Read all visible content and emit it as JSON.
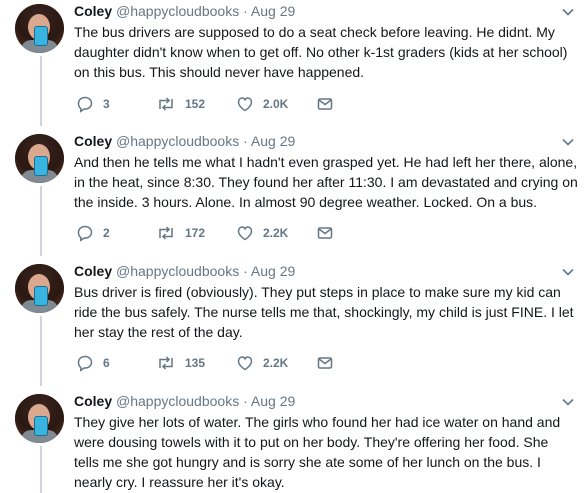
{
  "tweets": [
    {
      "name": "Coley",
      "handle": "@happycloudbooks",
      "sep": "·",
      "date": "Aug 29",
      "lines": [
        "The bus drivers are supposed to do a seat check before leaving. He didnt. My",
        "daughter didn't know when to get off. No other k-1st graders (kids at her school)",
        "on this bus. This should never have happened."
      ],
      "replies": "3",
      "retweets": "152",
      "likes": "2.0K"
    },
    {
      "name": "Coley",
      "handle": "@happycloudbooks",
      "sep": "·",
      "date": "Aug 29",
      "lines": [
        "And then he tells me what I hadn't even grasped yet. He had left her there, alone,",
        "in the heat, since 8:30. They found her after 11:30. I am devastated and crying on",
        "the inside. 3 hours. Alone. In almost 90 degree weather. Locked. On a bus."
      ],
      "replies": "2",
      "retweets": "172",
      "likes": "2.2K"
    },
    {
      "name": "Coley",
      "handle": "@happycloudbooks",
      "sep": "·",
      "date": "Aug 29",
      "lines": [
        "Bus driver is fired (obviously). They put steps in place to make sure my kid can",
        "ride the bus safely. The nurse tells me that, shockingly, my child is just FINE. I let",
        "her stay the rest of the day."
      ],
      "replies": "6",
      "retweets": "135",
      "likes": "2.2K"
    },
    {
      "name": "Coley",
      "handle": "@happycloudbooks",
      "sep": "·",
      "date": "Aug 29",
      "lines": [
        "They give her lots of water. The girls who found her had ice water on hand and",
        "were dousing towels with it to put on her body. They're offering her food. She",
        "tells me she got hungry and is sorry she ate some of her lunch on the bus. I",
        "nearly cry. I reassure her it's okay."
      ]
    }
  ],
  "colors": {
    "text": "#14171a",
    "secondary": "#657786",
    "thread_line": "#ccd6dd"
  },
  "icons": [
    "chevron-down-icon",
    "reply-icon",
    "retweet-icon",
    "like-icon",
    "direct-message-icon"
  ]
}
